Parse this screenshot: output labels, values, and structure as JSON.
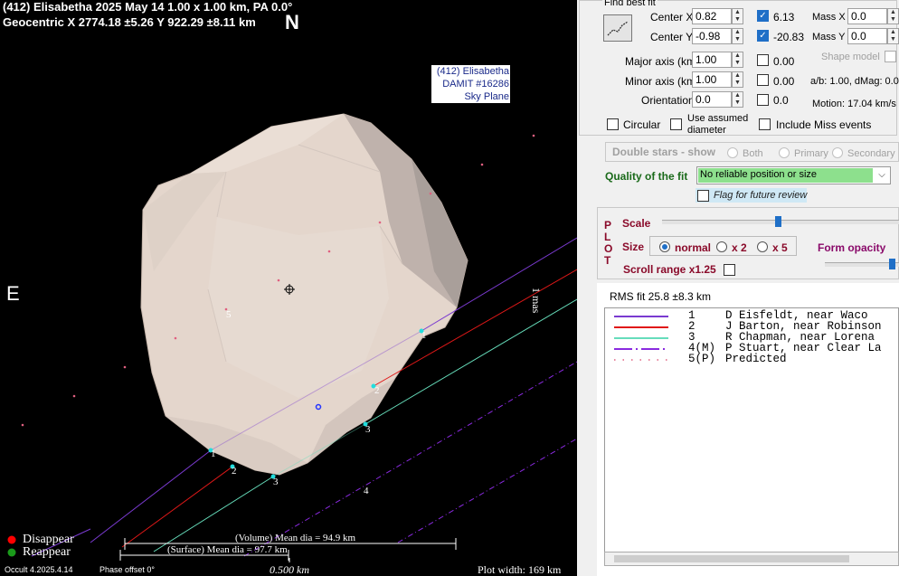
{
  "plot": {
    "title_line1": "(412) Elisabetha  2025 May 14   1.00 x 1.00 km, PA 0.0°",
    "title_line2": "Geocentric  X  2774.18 ±5.26  Y 922.29 ±8.11 km",
    "north_label": "N",
    "east_label": "E",
    "label_box": [
      "(412) Elisabetha",
      "DAMIT #16286",
      "Sky Plane"
    ],
    "mas_label": "1 mas",
    "chord_numbers": [
      "1",
      "2",
      "3",
      "4",
      "5"
    ],
    "legend_disappear": "Disappear",
    "legend_reappear": "Reappear",
    "volume_dia": "(Volume) Mean dia = 94.9 km",
    "surface_dia": "(Surface) Mean dia = 97.7 km",
    "version": "Occult 4.2025.4.14",
    "phase_offset": "Phase offset 0°",
    "scale_label": "0.500 km",
    "plot_width": "Plot width: 169 km",
    "colors": {
      "disappear": "#ff0000",
      "reappear": "#1a9a1a",
      "chord1": "#7a3ad0",
      "chord2": "#e01818",
      "chord3": "#66ddbb",
      "chord4": "#8a2ae0",
      "predicted": "#e06080",
      "shape": "#e6d8cf"
    }
  },
  "panel": {
    "find_best_fit": "Find best fit",
    "fit_icon": "line-fit-icon",
    "center_x_label": "Center X",
    "center_x_value": "0.82",
    "center_x_result": "6.13",
    "center_y_label": "Center Y",
    "center_y_value": "-0.98",
    "center_y_result": "-20.83",
    "mass_x_label": "Mass X",
    "mass_x_value": "0.0",
    "mass_y_label": "Mass Y",
    "mass_y_value": "0.0",
    "shape_model_label": "Shape model",
    "major_axis_label": "Major axis (km)",
    "major_axis_value": "1.00",
    "major_axis_result": "0.00",
    "minor_axis_label": "Minor axis (km)",
    "minor_axis_value": "1.00",
    "minor_axis_result": "0.00",
    "ab_text": "a/b: 1.00, dMag: 0.0",
    "orientation_label": "Orientation",
    "orientation_value": "0.0",
    "orientation_result": "0.0",
    "motion_text": "Motion: 17.04 km/s",
    "circular_label": "Circular",
    "assumed_label_1": "Use assumed",
    "assumed_label_2": "diameter",
    "include_miss_label": "Include Miss events",
    "double_stars_label": "Double stars - show",
    "both_label": "Both",
    "primary_label": "Primary",
    "secondary_label": "Secondary",
    "quality_label": "Quality of the fit",
    "quality_value": "No reliable position or size",
    "flag_label": "Flag for future review",
    "plot_vertical": [
      "P",
      "L",
      "O",
      "T"
    ],
    "scale_label": "Scale",
    "size_label": "Size",
    "size_normal": "normal",
    "size_x2": "x 2",
    "size_x5": "x 5",
    "form_opacity_label": "Form opacity",
    "scroll_range_label": "Scroll range x1.25",
    "rms_text": "RMS fit 25.8 ±8.3 km",
    "observers": [
      {
        "num": "1",
        "name": "D Eisfeldt, near Waco",
        "color": "#7a3ad0",
        "style": "solid"
      },
      {
        "num": "2",
        "name": "J Barton, near Robinson",
        "color": "#e01818",
        "style": "solid"
      },
      {
        "num": "3",
        "name": "R Chapman, near Lorena",
        "color": "#66ddbb",
        "style": "solid"
      },
      {
        "num": "4(M)",
        "name": "P Stuart, near Clear La",
        "color": "#8a2ae0",
        "style": "dashdot"
      },
      {
        "num": "5(P)",
        "name": "Predicted",
        "color": "#e06080",
        "style": "dotted"
      }
    ]
  }
}
